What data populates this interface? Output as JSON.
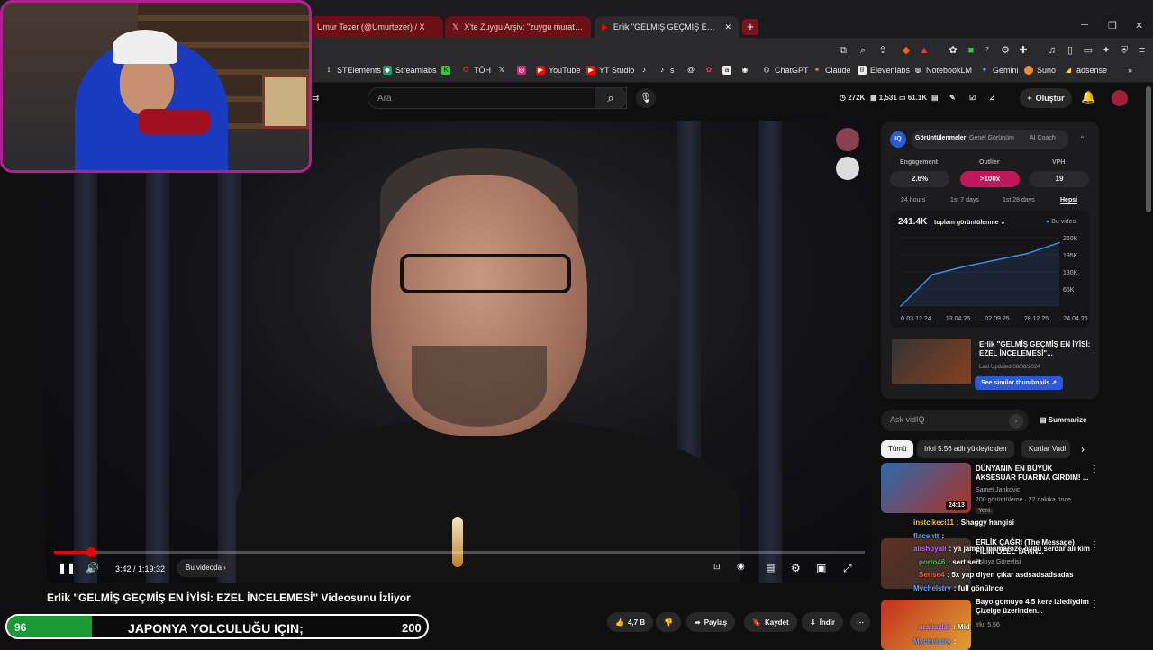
{
  "browser": {
    "tabs": [
      {
        "label": "Umur Tezer (@Umurtezer) / X"
      },
      {
        "label": "X'te Zuygu Arşiv: \"zuygu murat soner"
      },
      {
        "label": "Erlik \"GELMİŞ GEÇMİŞ EN İYİSİ"
      }
    ],
    "new_tab": "+",
    "bookmarks": [
      "STElements",
      "Streamlabs",
      "TÖH",
      "YouTube",
      "YT Studio",
      "s",
      "ChatGPT",
      "Claude",
      "Elevenlabs",
      "NotebookLM",
      "Gemini",
      "Suno",
      "adsense"
    ]
  },
  "youtube": {
    "search_placeholder": "Ara",
    "stats": {
      "subs": "272K",
      "videos": "1,531",
      "views": "61.1K"
    },
    "create_label": "Oluştur"
  },
  "player": {
    "progress": 0.046,
    "time": "3:42 / 1:19:32",
    "chapter": "Bu videoda",
    "chapter_arrow": "›"
  },
  "video": {
    "title": "Erlik \"GELMİŞ GEÇMİŞ EN İYİSİ: EZEL İNCELEMESİ\" Videosunu İzliyor",
    "actions": {
      "likes": "4,7 B",
      "share": "Paylaş",
      "save": "Kaydet",
      "download": "İndir"
    }
  },
  "overlay": {
    "left": "96",
    "middle": "JAPONYA YOLCULUĞU IÇIN;",
    "right": "200",
    "progress": 0.2
  },
  "vidiq": {
    "logo": "IQ",
    "tabs": [
      "Görüntülenmeler",
      "Genel Görünüm",
      "AI Coach"
    ],
    "metrics": [
      {
        "head": "Engagement",
        "value": "2.6%"
      },
      {
        "head": "Outlier",
        "value": ">100x"
      },
      {
        "head": "VPH",
        "value": "19"
      }
    ],
    "ranges": [
      "24 hours",
      "1st 7 days",
      "1st 28 days",
      "Hepsi"
    ],
    "total": "241.4K",
    "total_label": "toplam görüntülenme",
    "legend": "Bu video",
    "video_title": "Erlik \"GELMİŞ GEÇMİŞ EN İYİSİ: EZEL İNCELEMESİ\"...",
    "updated": "Last Updated 08/08/2024",
    "similar_button": "See similar thumbnails",
    "ask_placeholder": "Ask vidIQ",
    "summarize": "Summarize"
  },
  "chart_data": {
    "type": "line",
    "x": [
      "03.12.24",
      "13.04.25",
      "02.09.25",
      "28.12.25",
      "24.04.26"
    ],
    "x_axis_start_label": "0",
    "y_ticks": [
      "260K",
      "195K",
      "130K",
      "65K",
      "0"
    ],
    "ylim": [
      0,
      260000
    ],
    "series": [
      {
        "name": "Bu video",
        "values": [
          0,
          120000,
          150000,
          175000,
          200000,
          241400
        ]
      }
    ]
  },
  "chips": [
    "Tümü",
    "Irkıl 5.56 adlı yükleyiciden",
    "Kurtlar Vadi"
  ],
  "recommendations": [
    {
      "title": "DÜNYANIN EN BÜYÜK AKSESUAR FUARINA GİRDİM! ...",
      "channel": "Samet Jankovic",
      "meta": "200 görüntüleme · 22 dakika önce",
      "badge": "Yeni",
      "duration": "24:13"
    },
    {
      "title": "ERLİK ÇAĞRI (The Message) FİLMİ ÖZEL TAYİN...",
      "channel": "Eşkıya Görevlisi",
      "meta": ""
    },
    {
      "title": "Bayo gomuyo 4.5 kere izlediydim Çizelge üzerinden...",
      "channel": "Irkıl 5.56",
      "meta": ""
    }
  ],
  "chat": [
    {
      "user": "instcikeci11",
      "msg": ": Shaggy hangisi",
      "color": "#f0c040"
    },
    {
      "user": "flacentt",
      "msg": ":",
      "color": "#60a0ff"
    },
    {
      "user": "alishoyali",
      "msg": ": ya jamen mamarozo oydu serdar ali kim",
      "color": "#c060ff"
    },
    {
      "user": "porto46",
      "msg": ": sert sert",
      "color": "#40c060"
    },
    {
      "user": "Serise4",
      "msg": ": 5x yap diyen çıkar asdsadsadsadas",
      "color": "#f06040"
    },
    {
      "user": "Mychelstry",
      "msg": ": full gönülnce",
      "color": "#60a0ff"
    },
    {
      "user": "arabazlar",
      "msg": ": Mid",
      "color": "#c080ff"
    },
    {
      "user": "Mychelstry",
      "msg": ":",
      "color": "#60a0ff"
    }
  ]
}
